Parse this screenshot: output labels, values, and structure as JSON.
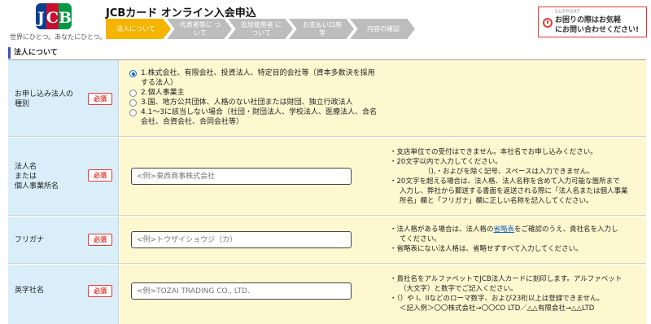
{
  "header": {
    "logo_letters": [
      "J",
      "C",
      "B"
    ],
    "slogan": "世界にひとつ。あなたにひとつ。",
    "title": "JCBカード オンライン入会申込",
    "steps": [
      {
        "label": "法人について",
        "active": true
      },
      {
        "label": "代表者等に ついて",
        "active": false
      },
      {
        "label": "追加使用者 について",
        "active": false
      },
      {
        "label": "お支払い口座 等",
        "active": false
      },
      {
        "label": "内容の確認",
        "active": false
      }
    ],
    "support": {
      "tag": "SUPPORT",
      "line1": "お困りの際はお気軽",
      "line2": "にお問い合わせください!"
    }
  },
  "section_title": "法人について",
  "required_label": "必須",
  "rows": {
    "entity_type": {
      "label_lines": [
        "お申し込み法人の",
        "種別"
      ],
      "options": [
        {
          "label": "1.株式会社、有限会社、投資法人、特定目的会社等（資本多数決を採用",
          "label2": "する法人）",
          "checked": true
        },
        {
          "label": "2.個人事業主",
          "checked": false
        },
        {
          "label": "3.国、地方公共団体、人格のない社団または財団、独立行政法人",
          "checked": false
        },
        {
          "label": "4.1〜3に該当しない場合（社団・財団法人、学校法人、医療法人、合名",
          "label2": "会社、合資会社、合同会社等）",
          "checked": false
        }
      ]
    },
    "company_name": {
      "label_lines": [
        "法人名",
        "または",
        "個人事業所名"
      ],
      "placeholder": "<例>東西商事株式会社",
      "notes": [
        "・支店単位での受付はできません。本社名でお申し込みください。",
        "・20文字以内で入力してください。",
        "（),・およびを除く記号、スペースは入力できません。",
        "・20文字を超える場合は、法人格、法人名称を含めて入力可能な箇所まで",
        "入力し、弊社から郵送する書面を返送される際に「法人名または個人事業",
        "所名」欄と「フリガナ」欄に正しい名称を記入してください。"
      ]
    },
    "furigana": {
      "label_lines": [
        "フリガナ"
      ],
      "placeholder": "<例>トウザイショウジ（カ）",
      "notes_prefix": "・法人格がある場合は、法人格の",
      "notes_link": "省略表",
      "notes_suffix": "をご確認のうえ、貴社名を入力し",
      "notes": [
        "てください。",
        "・省略表にない法人格は、省略せずすべて入力してください。"
      ]
    },
    "english_name": {
      "label_lines": [
        "英字社名"
      ],
      "placeholder": "<例>TOZAI TRADING CO., LTD.",
      "notes": [
        "・貴社名をアルファベットでJCB法人カードに刻印します。アルファベット",
        "（大文字）と数字でご記入ください。",
        "・（）や I、IIなどのローマ数字、および23桁以上は登録できません。",
        "＜記入例＞〇〇株式会社→〇〇CO LTD／△△有限会社→△△LTD"
      ]
    }
  }
}
